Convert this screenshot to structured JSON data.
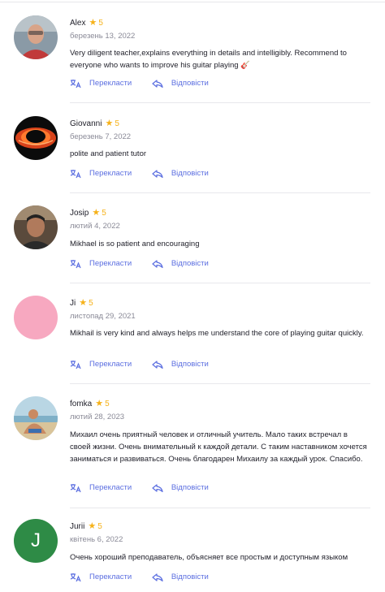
{
  "reviews": [
    {
      "name": "Alex",
      "rating": "5",
      "date": "березень 13, 2022",
      "text": "Very diligent teacher,explains everything in details and intelligibly. Recommend to everyone who wants to improve his guitar playing 🎸",
      "avatar": "photo-avatar-man-glasses"
    },
    {
      "name": "Giovanni",
      "rating": "5",
      "date": "березень 7, 2022",
      "text": "polite and patient tutor",
      "avatar": "black-hole-avatar"
    },
    {
      "name": "Josip",
      "rating": "5",
      "date": "лютий 4, 2022",
      "text": "Mikhael is so patient and encouraging",
      "avatar": "photo-avatar-man-dark"
    },
    {
      "name": "Ji",
      "rating": "5",
      "date": "листопад 29, 2021",
      "text": "Mikhail is very kind and always helps me understand the core of playing guitar quickly.",
      "avatar": "pink-circle-avatar"
    },
    {
      "name": "fomka",
      "rating": "5",
      "date": "лютий 28, 2023",
      "text": "Михаил очень приятный человек и отличный учитель. Мало таких встречал в своей жизни. Очень внимательный к каждой детали. С таким наставником хочется заниматься и развиваться. Очень благодарен Михаилу за каждый урок. Спасибо.",
      "avatar": "photo-avatar-beach"
    },
    {
      "name": "Jurii",
      "rating": "5",
      "date": "квітень 6, 2022",
      "text": "Очень хороший преподаватель, объясняет все простым и доступным языком",
      "avatar": "letter-avatar",
      "avatar_letter": "J"
    }
  ],
  "actions": {
    "translate": "Перекласти",
    "reply": "Відповісти"
  },
  "colors": {
    "star": "#f6b21a",
    "link": "#5b6ee0",
    "pink_avatar": "#f7a8c0",
    "green_avatar": "#2e8b46"
  }
}
